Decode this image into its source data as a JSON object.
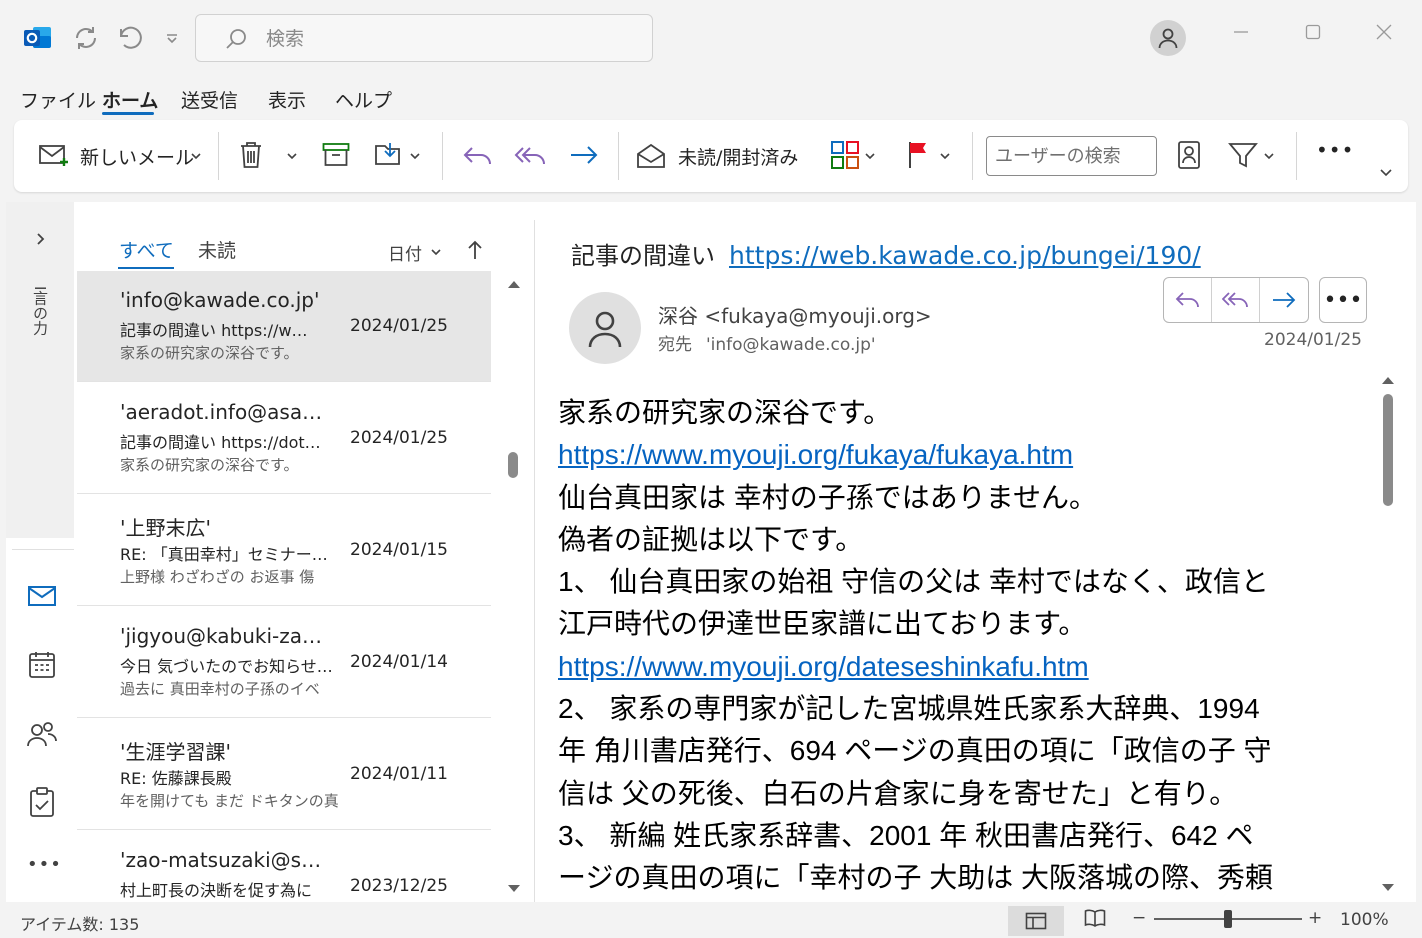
{
  "titlebar": {
    "search_placeholder": "検索"
  },
  "menu": [
    "ファイル",
    "ホーム",
    "送受信",
    "表示",
    "ヘルプ"
  ],
  "ribbon": {
    "new_mail": "新しいメール",
    "read_unread": "未読/開封済み",
    "user_search_placeholder": "ユーザーの検索",
    "more": "•••"
  },
  "nav": {
    "vertical_label": "I言の力"
  },
  "list": {
    "tab_all": "すべて",
    "tab_unread": "未読",
    "sort_label": "日付",
    "messages": [
      {
        "from": "'info@kawade.co.jp'",
        "subject": "記事の間違い https://w…",
        "date": "2024/01/25",
        "preview": "家系の研究家の深谷です。"
      },
      {
        "from": "'aeradot.info@asa…",
        "subject": "記事の間違い https://dot…",
        "date": "2024/01/25",
        "preview": "家系の研究家の深谷です。"
      },
      {
        "from": "'上野末広'",
        "subject": "RE: 「真田幸村」セミナーの件",
        "date": "2024/01/15",
        "preview": "上野様 わざわざの お返事 傷"
      },
      {
        "from": "'jigyou@kabuki-za…",
        "subject": "今日 気づいたのでお知らせ…",
        "date": "2024/01/14",
        "preview": "過去に 真田幸村の子孫のイベ"
      },
      {
        "from": "'生涯学習課'",
        "subject": "RE: 佐藤課長殿",
        "date": "2024/01/11",
        "preview": "年を開けても まだ ドキタンの真"
      },
      {
        "from": "'zao-matsuzaki@s…",
        "subject": "村上町長の決断を促す為に",
        "date": "2023/12/25",
        "preview": ""
      }
    ]
  },
  "reading": {
    "subject": "記事の間違い",
    "subject_link": "https://web.kawade.co.jp/bungei/190/",
    "sender": "深谷 <fukaya@myouji.org>",
    "to_label": "宛先",
    "to_value": "'info@kawade.co.jp'",
    "date": "2024/01/25",
    "more": "•••",
    "body": [
      {
        "text": "家系の研究家の深谷です。",
        "link": false
      },
      {
        "text": "https://www.myouji.org/fukaya/fukaya.htm",
        "link": true
      },
      {
        "text": "仙台真田家は 幸村の子孫ではありません。",
        "link": false
      },
      {
        "text": "偽者の証拠は以下です。",
        "link": false
      },
      {
        "text": "1、 仙台真田家の始祖 守信の父は 幸村ではなく、政信と",
        "link": false
      },
      {
        "text": "江戸時代の伊達世臣家譜に出ております。",
        "link": false
      },
      {
        "text": "https://www.myouji.org/dateseshinkafu.htm",
        "link": true
      },
      {
        "text": "2、 家系の専門家が記した宮城県姓氏家系大辞典、1994",
        "link": false
      },
      {
        "text": "年 角川書店発行、694 ページの真田の項に「政信の子 守",
        "link": false
      },
      {
        "text": "信は 父の死後、白石の片倉家に身を寄せた」と有り。",
        "link": false
      },
      {
        "text": "3、 新編 姓氏家系辞書、2001 年 秋田書店発行、642 ペ",
        "link": false
      },
      {
        "text": "ージの真田の項に「幸村の子 大助は 大阪落城の際、秀頼",
        "link": false
      }
    ]
  },
  "status": {
    "item_count": "アイテム数: 135",
    "zoom_minus": "−",
    "zoom_plus": "+",
    "zoom": "100%",
    "zoom_level_percent": 50
  },
  "colors": {
    "accent": "#0f6cbd",
    "link": "#0563c1",
    "reply_purple": "#8764b8"
  }
}
